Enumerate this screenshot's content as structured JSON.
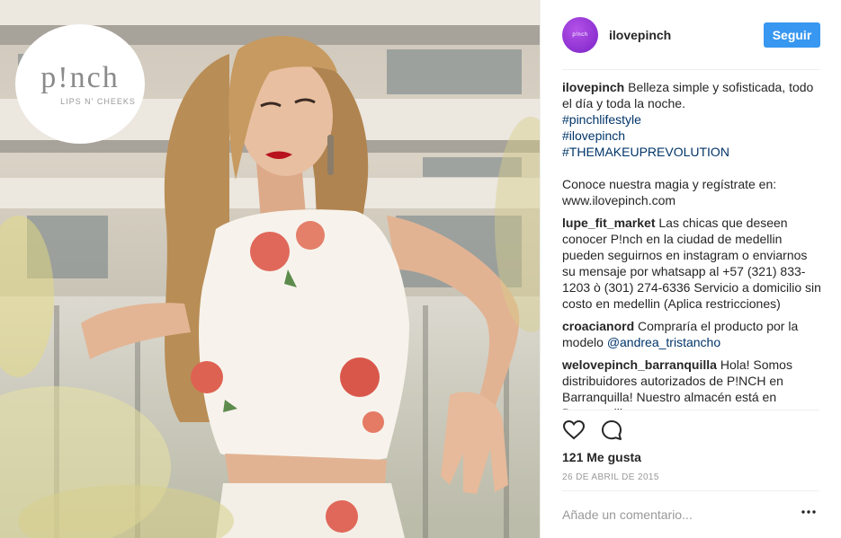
{
  "brand": {
    "logo_text": "p!nch",
    "logo_subtext": "LIPS N' CHEEKS",
    "accent": "#3897f0",
    "link_color": "#003569",
    "avatar_color": "#9b3ddb"
  },
  "header": {
    "avatar_text": "p!nch",
    "username": "ilovepinch",
    "follow_label": "Seguir"
  },
  "caption": {
    "user": "ilovepinch",
    "text": "Belleza simple y sofisticada, todo el día y toda la noche.",
    "hashtags": [
      "#pinchlifestyle",
      "#ilovepinch",
      "#THEMAKEUPREVOLUTION"
    ],
    "cta": "Conoce nuestra magia y regístrate en: www.ilovepinch.com"
  },
  "comments": [
    {
      "user": "lupe_fit_market",
      "text": "Las chicas que deseen conocer P!nch en la ciudad de medellin pueden seguirnos en instagram o enviarnos su mensaje por whatsapp al +57 (321) 833-1203 ò (301) 274-6336 Servicio a domicilio sin costo en medellin (Aplica restricciones)"
    },
    {
      "user": "croacianord",
      "text": "Compraría el producto por la modelo",
      "mention": "@andrea_tristancho"
    },
    {
      "user": "welovepinch_barranquilla",
      "text": "Hola! Somos distribuidores autorizados de P!NCH en Barranquilla! Nuestro almacén está en Barranquilla"
    }
  ],
  "actions": {
    "like_icon": "heart-icon",
    "comment_icon": "comment-icon"
  },
  "likes": "121 Me gusta",
  "date": "26 DE ABRIL DE 2015",
  "comment_input": {
    "placeholder": "Añade un comentario..."
  },
  "more_icon": "more-options-icon"
}
